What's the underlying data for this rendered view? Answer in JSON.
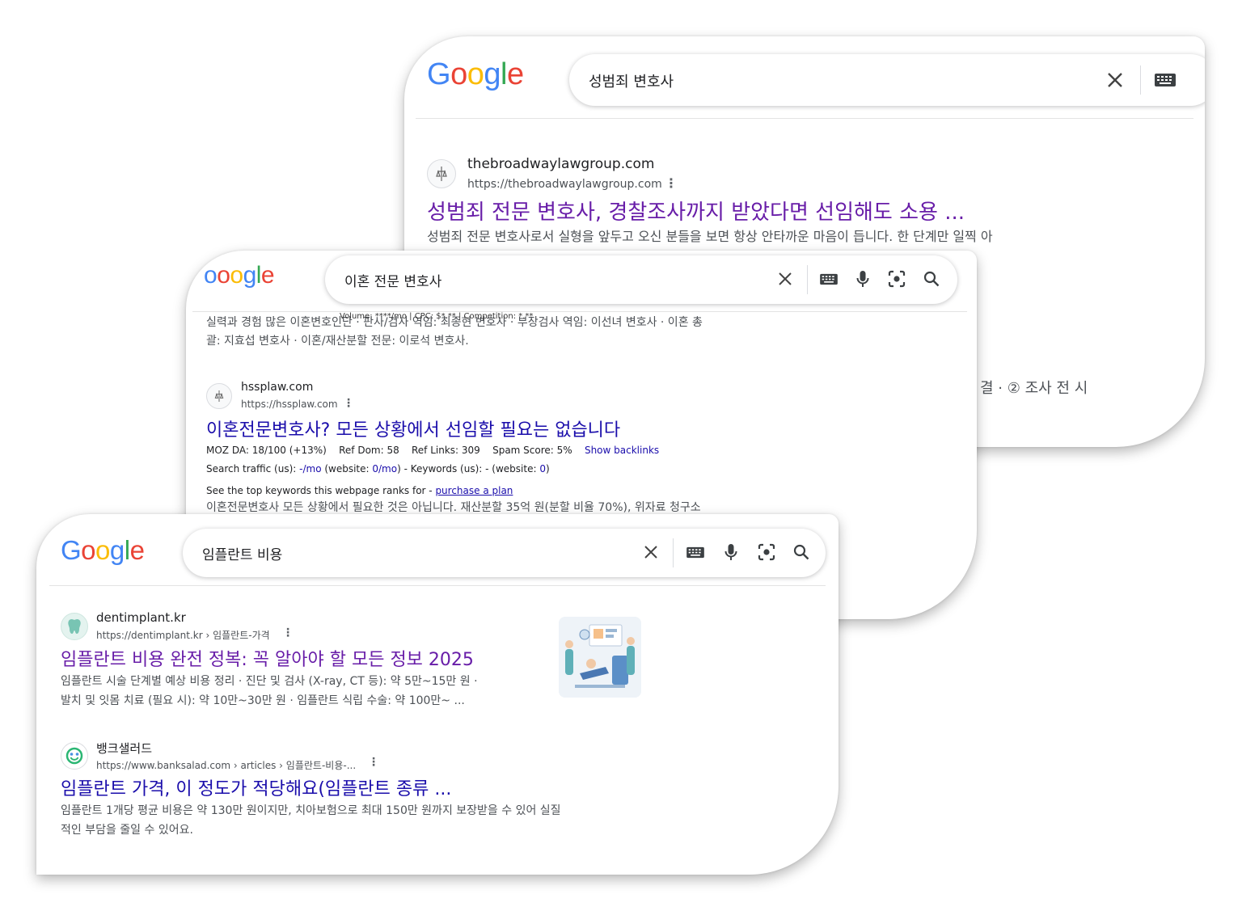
{
  "colors": {
    "title_visited": "#681da8",
    "link_blue": "#1a0dab",
    "snippet": "#4d5156"
  },
  "logo_letters": [
    "G",
    "o",
    "o",
    "g",
    "l",
    "e"
  ],
  "card1": {
    "query": "성범죄 변호사",
    "result": {
      "site": "thebroadwaylawgroup.com",
      "url": "https://thebroadwaylawgroup.com",
      "title": "성범죄 전문 변호사, 경찰조사까지 받았다면 선임해도 소용 ...",
      "snippet": "성범죄 전문 변호사로서 실형을 앞두고 오신 분들을 보면 항상 안타까운 마음이 듭니다. 한 단계만 일찍 아"
    },
    "peek_text": "결 · ② 조사 전 시",
    "icons": [
      "close-icon",
      "keyboard-icon"
    ]
  },
  "card2": {
    "query": "이혼 전문 변호사",
    "logo_text": "ooogle",
    "overlay_text": "Volume: ****/mo | CPC: $*.** | Competition: *.**",
    "snippet_top": [
      "실력과 경험 많은 이혼변호인단 · 판사/검사 역임: 최종현 변호사 · 부장검사 역임: 이선녀 변호사 · 이혼 총",
      "괄: 지효섭 변호사 · 이혼/재산분할 전문: 이로석 변호사."
    ],
    "result": {
      "site": "hssplaw.com",
      "url": "https://hssplaw.com",
      "title": "이혼전문변호사? 모든 상황에서 선임할 필요는 없습니다",
      "seo_line1": {
        "moz": "MOZ DA: 18/100 (+13%)",
        "ref_dom": "Ref Dom: 58",
        "ref_links": "Ref Links: 309",
        "spam": "Spam Score: 5%",
        "show_backlinks": "Show backlinks"
      },
      "seo_line2": {
        "prefix": "Search traffic (us): ",
        "traffic": "-/mo",
        "website1": " (website: ",
        "website1_val": "0/mo",
        "kw": ") - Keywords (us): - (website: ",
        "kw_val": "0",
        "end": ")"
      },
      "seo_line3": {
        "prefix": "See the top keywords this webpage ranks for - ",
        "link": "purchase a plan"
      },
      "snippet": "이혼전문변호사 모든 상황에서 필요한 것은 아닙니다. 재산분할 35억 원(분할 비율 70%), 위자료 청구소"
    },
    "icons": [
      "close-icon",
      "keyboard-icon",
      "mic-icon",
      "lens-icon",
      "search-icon"
    ]
  },
  "card3": {
    "query": "임플란트 비용",
    "results": [
      {
        "site": "dentimplant.kr",
        "url": "https://dentimplant.kr › 임플란트-가격",
        "title": "임플란트 비용 완전 정복: 꼭 알아야 할 모든 정보 2025",
        "snippet": [
          "임플란트 시술 단계별 예상 비용 정리 · 진단 및 검사 (X-ray, CT 등): 약 5만~15만 원 ·",
          "발치 및 잇몸 치료 (필요 시): 약 10만~30만 원 · 임플란트 식립 수술: 약 100만~ ..."
        ],
        "thumb_icon": "dental-clinic-illustration-icon"
      },
      {
        "site": "뱅크샐러드",
        "url": "https://www.banksalad.com › articles › 임플란트-비용-...",
        "title": "임플란트 가격, 이 정도가 적당해요(임플란트 종류 ...",
        "snippet": [
          "임플란트 1개당 평균 비용은 약 130만 원이지만, 치아보험으로 최대 150만 원까지 보장받을 수 있어 실질",
          "적인 부담을 줄일 수 있어요."
        ]
      }
    ],
    "icons": [
      "close-icon",
      "keyboard-icon",
      "mic-icon",
      "lens-icon",
      "search-icon"
    ]
  }
}
